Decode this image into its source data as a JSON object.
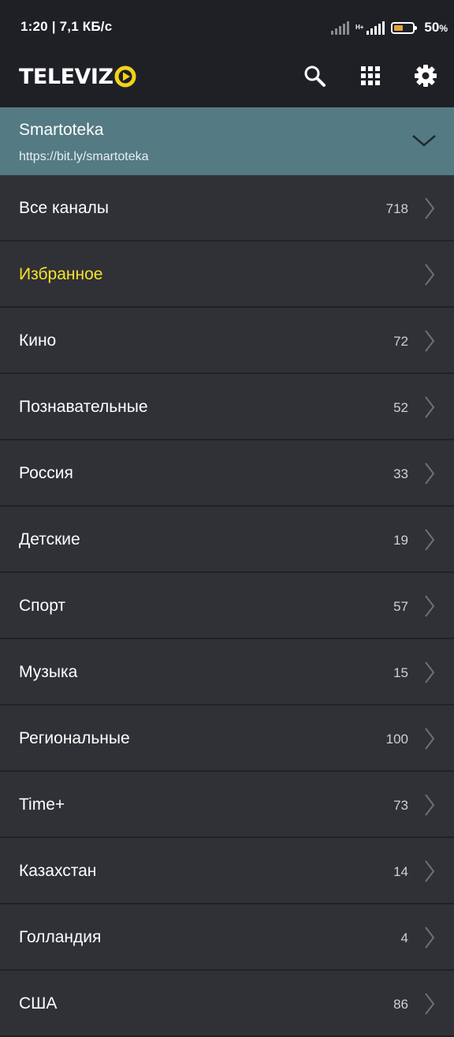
{
  "status_bar": {
    "time_speed": "1:20 | 7,1 КБ/с",
    "network_type": "H+",
    "battery_percent": "50",
    "battery_unit": "%",
    "battery_level": 0.5,
    "battery_color": "#e3a33a"
  },
  "app_bar": {
    "logo_text": "TELEVIZ",
    "logo_accent_color": "#f2d21b",
    "icons": [
      "search-icon",
      "grid-icon",
      "gear-icon"
    ]
  },
  "playlist": {
    "name": "Smartoteka",
    "url": "https://bit.ly/smartoteka",
    "background_color": "#547a83"
  },
  "categories": [
    {
      "label": "Все каналы",
      "count": "718"
    },
    {
      "label": "Избранное",
      "count": ""
    },
    {
      "label": "Кино",
      "count": "72"
    },
    {
      "label": "Познавательные",
      "count": "52"
    },
    {
      "label": "Россия",
      "count": "33"
    },
    {
      "label": "Детские",
      "count": "19"
    },
    {
      "label": "Спорт",
      "count": "57"
    },
    {
      "label": "Музыка",
      "count": "15"
    },
    {
      "label": "Региональные",
      "count": "100"
    },
    {
      "label": "Time+",
      "count": "73"
    },
    {
      "label": "Казахстан",
      "count": "14"
    },
    {
      "label": "Голландия",
      "count": "4"
    },
    {
      "label": "США",
      "count": "86"
    }
  ],
  "colors": {
    "favorites_label": "#f5e32a",
    "background": "#303137",
    "bar_background": "#1f2026"
  }
}
